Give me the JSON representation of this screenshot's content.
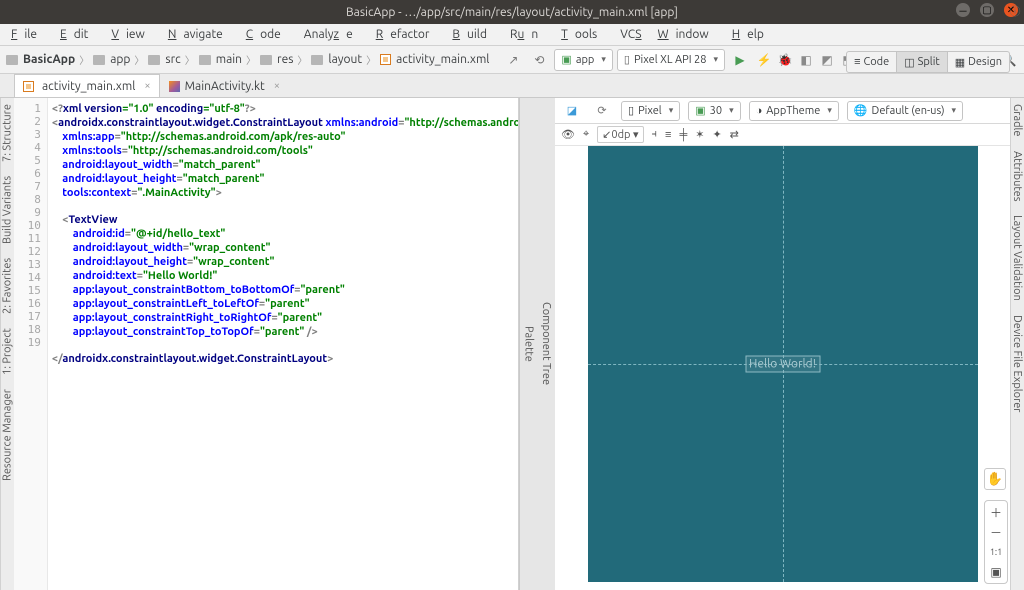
{
  "title": "BasicApp - …/app/src/main/res/layout/activity_main.xml [app]",
  "menu": [
    "File",
    "Edit",
    "View",
    "Navigate",
    "Code",
    "Analyze",
    "Refactor",
    "Build",
    "Run",
    "Tools",
    "VCS",
    "Window",
    "Help"
  ],
  "breadcrumbs": [
    "BasicApp",
    "app",
    "src",
    "main",
    "res",
    "layout",
    "activity_main.xml"
  ],
  "run_config": "app",
  "device_combo": "Pixel XL API 28",
  "tabs": [
    {
      "name": "activity_main.xml",
      "active": true,
      "kind": "xml"
    },
    {
      "name": "MainActivity.kt",
      "active": false,
      "kind": "kt"
    }
  ],
  "view_modes": {
    "code": "Code",
    "split": "Split",
    "design": "Design",
    "active": "split"
  },
  "left_tools": [
    "Resource Manager",
    "1: Project",
    "2: Favorites",
    "Build Variants",
    "7: Structure"
  ],
  "right_tools": [
    "Gradle",
    "Attributes",
    "Layout Validation",
    "Device File Explorer"
  ],
  "designer_top": {
    "device": "Pixel",
    "api": "30",
    "theme": "AppTheme",
    "locale": "Default (en-us)"
  },
  "designer_sub": {
    "margin": "0dp"
  },
  "preview_text": "Hello World!",
  "zoom_label": "1:1",
  "mini_panels": {
    "palette": "Palette",
    "tree": "Component Tree"
  },
  "code": {
    "lines": [
      1,
      2,
      3,
      4,
      5,
      6,
      7,
      8,
      9,
      10,
      11,
      12,
      13,
      14,
      15,
      16,
      17,
      18,
      19
    ],
    "l1_a": "<?",
    "l1_b": "xml version",
    "l1_c": "=\"1.0\"",
    "l1_d": " encoding",
    "l1_e": "=\"utf-8\"",
    "l1_f": "?>",
    "l2_a": "<",
    "l2_b": "androidx.constraintlayout.widget.ConstraintLayout",
    "l2_c": " xmlns:",
    "l2_d": "android",
    "l2_e": "=",
    "l2_f": "\"http://schemas.andro",
    "l3_a": "    xmlns:",
    "l3_b": "app",
    "l3_c": "=",
    "l3_d": "\"http://schemas.android.com/apk/res-auto\"",
    "l4_a": "    xmlns:",
    "l4_b": "tools",
    "l4_c": "=",
    "l4_d": "\"http://schemas.android.com/tools\"",
    "l5_a": "    android:",
    "l5_b": "layout_width",
    "l5_c": "=",
    "l5_d": "\"match_parent\"",
    "l6_a": "    android:",
    "l6_b": "layout_height",
    "l6_c": "=",
    "l6_d": "\"match_parent\"",
    "l7_a": "    tools:",
    "l7_b": "context",
    "l7_c": "=",
    "l7_d": "\".MainActivity\"",
    "l7_e": ">",
    "l9_a": "    <",
    "l9_b": "TextView",
    "l10_a": "        android:",
    "l10_b": "id",
    "l10_c": "=",
    "l10_d": "\"@+id/hello_text\"",
    "l11_a": "        android:",
    "l11_b": "layout_width",
    "l11_c": "=",
    "l11_d": "\"wrap_content\"",
    "l12_a": "        android:",
    "l12_b": "layout_height",
    "l12_c": "=",
    "l12_d": "\"wrap_content\"",
    "l13_a": "        android:",
    "l13_b": "text",
    "l13_c": "=",
    "l13_d": "\"Hello World!\"",
    "l14_a": "        app:",
    "l14_b": "layout_constraintBottom_toBottomOf",
    "l14_c": "=",
    "l14_d": "\"parent\"",
    "l15_a": "        app:",
    "l15_b": "layout_constraintLeft_toLeftOf",
    "l15_c": "=",
    "l15_d": "\"parent\"",
    "l16_a": "        app:",
    "l16_b": "layout_constraintRight_toRightOf",
    "l16_c": "=",
    "l16_d": "\"parent\"",
    "l17_a": "        app:",
    "l17_b": "layout_constraintTop_toTopOf",
    "l17_c": "=",
    "l17_d": "\"parent\"",
    "l17_e": " />",
    "l19_a": "</",
    "l19_b": "androidx.constraintlayout.widget.ConstraintLayout",
    "l19_c": ">"
  }
}
